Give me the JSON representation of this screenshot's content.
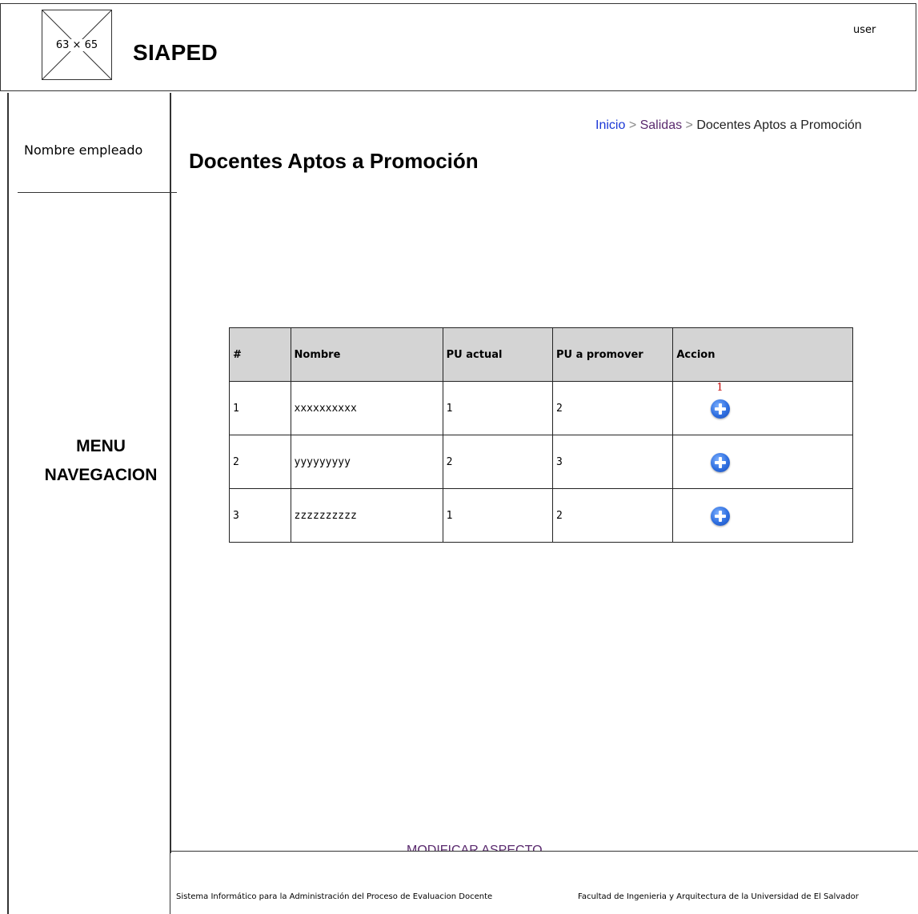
{
  "header": {
    "logo_placeholder": "63 × 65",
    "app_title": "SIAPED",
    "user": "user"
  },
  "sidebar": {
    "employee_name": "Nombre empleado",
    "menu_line1": "MENU",
    "menu_line2": "NAVEGACION"
  },
  "breadcrumb": {
    "items": [
      "Inicio",
      "Salidas",
      "Docentes Aptos a Promoción"
    ],
    "separator": ">"
  },
  "page": {
    "title": "Docentes Aptos a Promoción"
  },
  "table": {
    "headers": [
      "#",
      "Nombre",
      "PU actual",
      "PU a promover",
      "Accion"
    ],
    "rows": [
      {
        "num": "1",
        "nombre": "xxxxxxxxxx",
        "pu_actual": "1",
        "pu_promover": "2",
        "badge": "1"
      },
      {
        "num": "2",
        "nombre": "yyyyyyyyy",
        "pu_actual": "2",
        "pu_promover": "3"
      },
      {
        "num": "3",
        "nombre": "zzzzzzzzzz",
        "pu_actual": "1",
        "pu_promover": "2"
      }
    ],
    "action_icon": "plus-circle-icon"
  },
  "footer": {
    "modify_link": "MODIFICAR ASPECTO",
    "left_text": "Sistema Informático para la Administración del Proceso de Evaluacion Docente",
    "right_text": "Facultad de Ingenieria y Arquitectura de la Universidad de El Salvador"
  },
  "colors": {
    "link_blue": "#1a37d6",
    "link_purple": "#5a2a6e",
    "table_header_bg": "#d4d4d4",
    "badge_red": "#c00000",
    "action_blue": "#2f6fe0"
  }
}
